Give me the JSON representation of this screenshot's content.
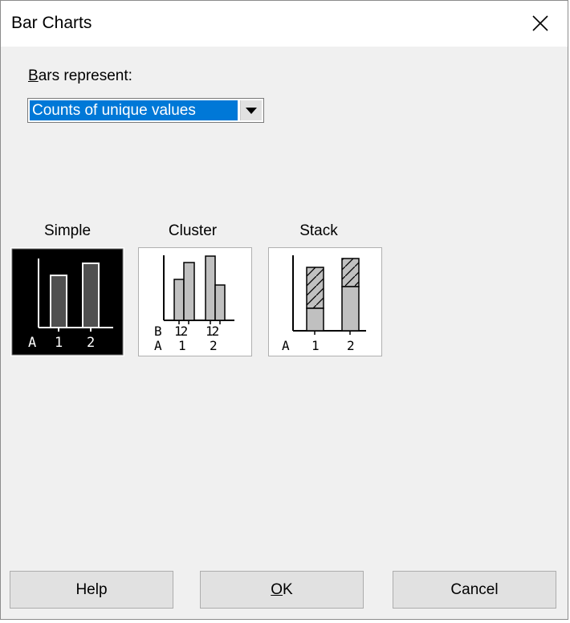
{
  "window": {
    "title": "Bar Charts"
  },
  "bars_represent": {
    "label_first": "B",
    "label_rest": "ars represent:",
    "selected": "Counts of unique values"
  },
  "chart_types": [
    {
      "label": "Simple",
      "selected": true
    },
    {
      "label": "Cluster",
      "selected": false
    },
    {
      "label": "Stack",
      "selected": false
    }
  ],
  "thumbnails": {
    "simple": {
      "axis_a": "A",
      "ticks": [
        "1",
        "2"
      ]
    },
    "cluster": {
      "axis_a": "A",
      "axis_b": "B",
      "groups": [
        "1",
        "2"
      ],
      "sub": [
        "12",
        "12"
      ]
    },
    "stack": {
      "axis_a": "A",
      "ticks": [
        "1",
        "2"
      ]
    }
  },
  "buttons": {
    "help": "Help",
    "ok_first": "O",
    "ok_rest": "K",
    "cancel": "Cancel"
  },
  "colors": {
    "selection_blue": "#0078d7",
    "dialog_bg": "#f0f0f0",
    "bar_gray": "#c0c0c0",
    "bar_dark": "#505050"
  }
}
